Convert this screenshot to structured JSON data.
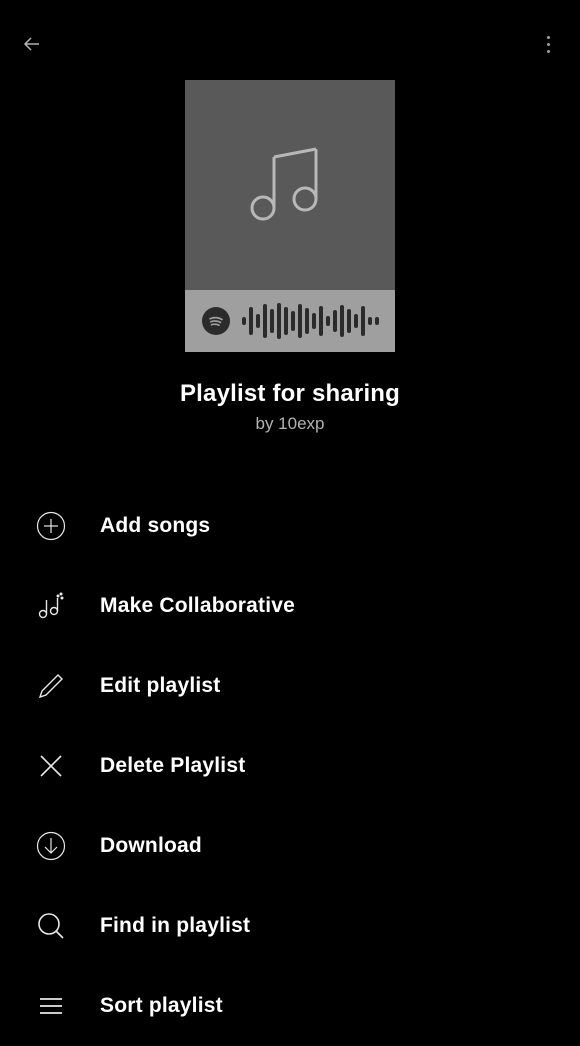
{
  "playlist": {
    "title": "Playlist for sharing",
    "author_prefix": "by ",
    "author": "10exp"
  },
  "menu": {
    "items": [
      {
        "icon": "plus-circle",
        "label": "Add songs"
      },
      {
        "icon": "music-collab",
        "label": "Make Collaborative"
      },
      {
        "icon": "pencil",
        "label": "Edit playlist"
      },
      {
        "icon": "x",
        "label": "Delete Playlist"
      },
      {
        "icon": "download-circle",
        "label": "Download"
      },
      {
        "icon": "search",
        "label": "Find in playlist"
      },
      {
        "icon": "lines",
        "label": "Sort playlist"
      }
    ]
  }
}
